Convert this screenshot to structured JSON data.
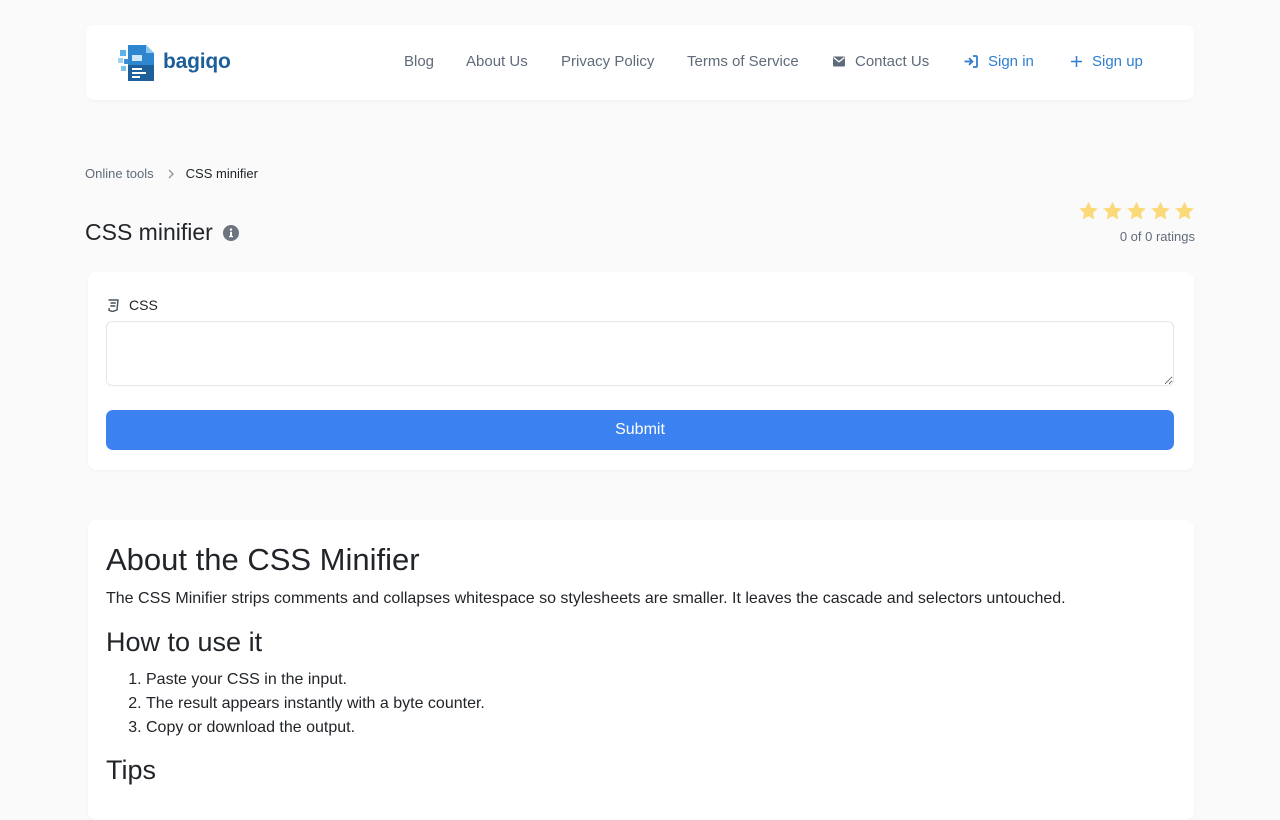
{
  "brand": {
    "name": "bagiqo"
  },
  "nav": {
    "blog": "Blog",
    "about": "About Us",
    "privacy": "Privacy Policy",
    "terms": "Terms of Service",
    "contact": "Contact Us",
    "signin": "Sign in",
    "signup": "Sign up"
  },
  "breadcrumb": {
    "parent": "Online tools",
    "current": "CSS minifier"
  },
  "page": {
    "title": "CSS minifier"
  },
  "rating": {
    "stars_total": 5,
    "stars_filled": 0,
    "text": "0 of 0 ratings"
  },
  "form": {
    "input_label": "CSS",
    "input_value": "",
    "input_placeholder": "",
    "submit_label": "Submit"
  },
  "about": {
    "title": "About the CSS Minifier",
    "description": "The CSS Minifier strips comments and collapses whitespace so stylesheets are smaller. It leaves the cascade and selectors untouched.",
    "howto_title": "How to use it",
    "steps": [
      "Paste your CSS in the input.",
      "The result appears instantly with a byte counter.",
      "Copy or download the output."
    ],
    "tips_title": "Tips"
  },
  "colors": {
    "accent": "#2f7fd0",
    "primary_button": "#3b82f0",
    "star": "#fcd978",
    "brand_text": "#1d5f9a"
  },
  "icons": {
    "contact": "envelope-icon",
    "signin": "sign-in-icon",
    "signup": "plus-icon",
    "title_info": "info-circle-icon",
    "field": "css3-icon",
    "breadcrumb_sep": "chevron-right-icon"
  }
}
